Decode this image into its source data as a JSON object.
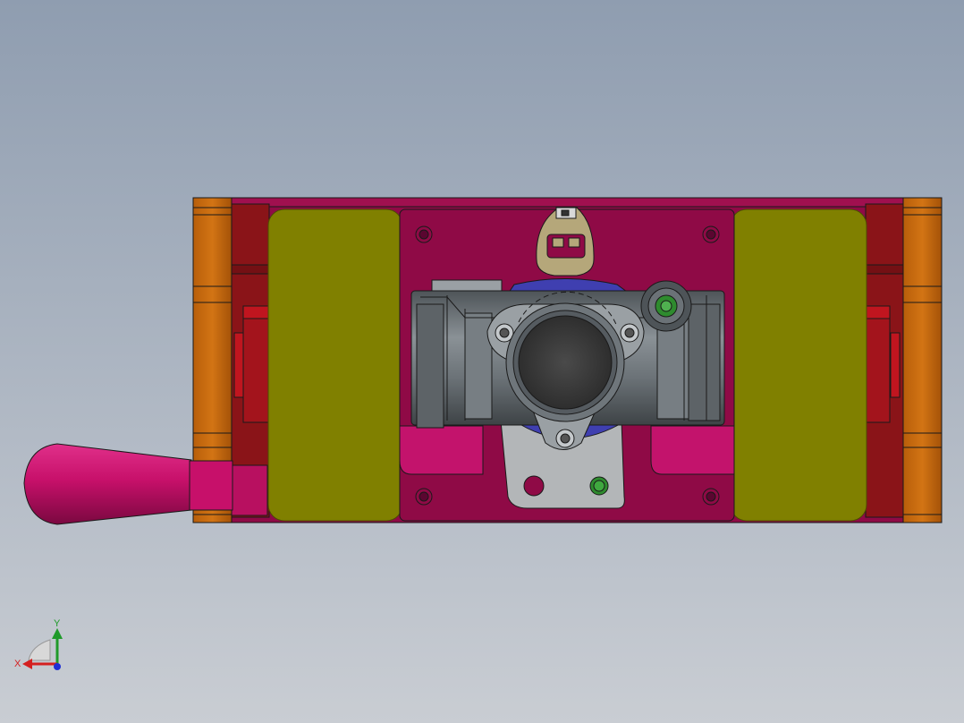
{
  "viewport": {
    "background_top": "#8f9db0",
    "background_bottom": "#c9cdd3"
  },
  "triad": {
    "x_label": "X",
    "y_label": "Y",
    "x_color": "#d42020",
    "y_color": "#1f9a2a",
    "z_color": "#1f2fd4"
  },
  "colors": {
    "base_plate": "#8f0a46",
    "plate_edge": "#5a0630",
    "side_block_orange": "#cc6b10",
    "side_block_shade": "#a45208",
    "guide_red": "#8a1418",
    "guide_red_light": "#c0151f",
    "yellow_pad": "#808000",
    "yellow_edge": "#5c5c00",
    "center_plate": "#8f0a46",
    "clamp_magenta": "#c3136c",
    "handle_magenta": "#c7106a",
    "housing_gray": "#6b7277",
    "housing_dark": "#3a3d40",
    "bracket_gray": "#b3b6b8",
    "connector_tan": "#b5a77a",
    "blue_seal": "#3f3fb0",
    "green_port": "#2e8b2e"
  }
}
